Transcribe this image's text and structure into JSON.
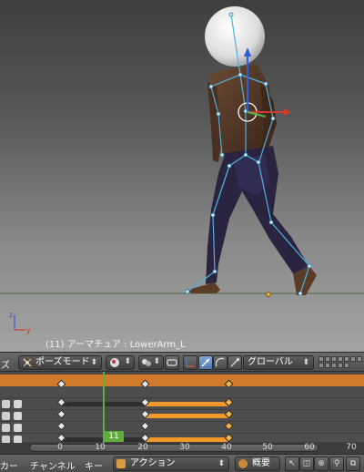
{
  "viewport": {
    "status_text": "(11) アーマチュア : LowerArm_L"
  },
  "header": {
    "left_label": "ズ",
    "mode": "ポーズモード",
    "arrow": "◆",
    "orientation": "グローバル"
  },
  "dopesheet": {
    "current_frame": "11",
    "ticks": [
      "0",
      "10",
      "20",
      "30",
      "40",
      "50",
      "60",
      "70"
    ]
  },
  "footer": {
    "menu_marker": "カー",
    "menu_channel": "チャンネル",
    "menu_key": "キー",
    "action": "アクション",
    "summary": "概要"
  },
  "colors": {
    "keyframe_hold": "#f0992a",
    "summary_row": "#d07a2c",
    "current_frame": "#5fae3c",
    "bone": "#4fb3e0"
  }
}
